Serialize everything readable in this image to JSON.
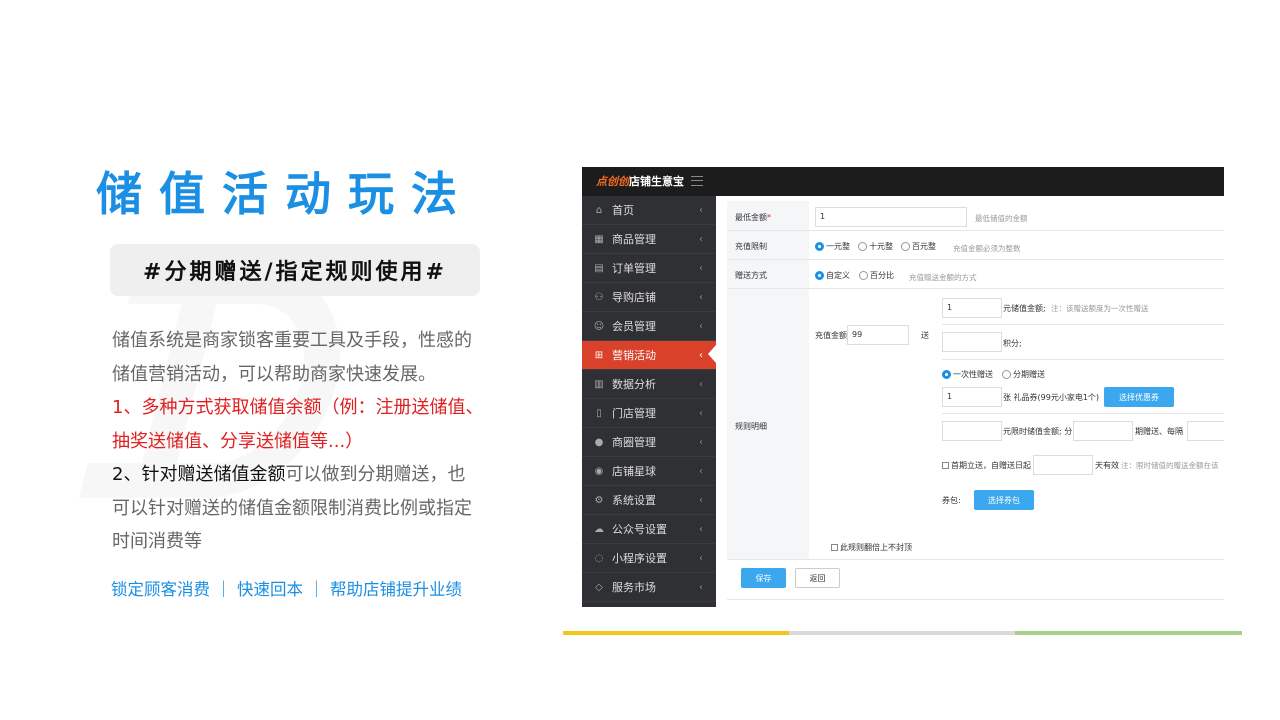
{
  "slide": {
    "title": "储值活动玩法",
    "tag": "#分期赠送/指定规则使用#",
    "desc": {
      "line1": "储值系统是商家锁客重要工具及手段，性感的",
      "line2": "储值营销活动，可以帮助商家快速发展。",
      "red1": "1、多种方式获取储值余额（例：注册送储值、",
      "red2": "抽奖送储值、分享送储值等...）",
      "item2_dark": "2、针对赠送储值金额",
      "item2_rest": "可以做到分期赠送，也",
      "line5": "可以针对赠送的储值金额限制消费比例或指定",
      "line6": "时间消费等"
    },
    "slogan": "锁定顾客消费 ｜ 快速回本 ｜  帮助店铺提升业绩",
    "bar_colors": [
      "#f5c518",
      "#d9d9d9",
      "#a8d08d"
    ]
  },
  "app": {
    "logo_accent": "点创创",
    "logo_text": "店铺生意宝",
    "sidebar": [
      {
        "label": "首页",
        "icon": "home-icon",
        "glyph": "⌂"
      },
      {
        "label": "商品管理",
        "icon": "grid-icon",
        "glyph": "▦"
      },
      {
        "label": "订单管理",
        "icon": "document-icon",
        "glyph": "▤"
      },
      {
        "label": "导购店铺",
        "icon": "org-icon",
        "glyph": "⚇"
      },
      {
        "label": "会员管理",
        "icon": "user-icon",
        "glyph": "☺"
      },
      {
        "label": "营销活动",
        "icon": "gift-icon",
        "glyph": "⊞"
      },
      {
        "label": "数据分析",
        "icon": "bar-chart-icon",
        "glyph": "▥"
      },
      {
        "label": "门店管理",
        "icon": "store-icon",
        "glyph": "▯"
      },
      {
        "label": "商圈管理",
        "icon": "circle-icon",
        "glyph": "●"
      },
      {
        "label": "店铺星球",
        "icon": "globe-icon",
        "glyph": "◉"
      },
      {
        "label": "系统设置",
        "icon": "gear-icon",
        "glyph": "⚙"
      },
      {
        "label": "公众号设置",
        "icon": "wechat-icon",
        "glyph": "☁"
      },
      {
        "label": "小程序设置",
        "icon": "chat-icon",
        "glyph": "◌"
      },
      {
        "label": "服务市场",
        "icon": "tag-icon",
        "glyph": "◇"
      }
    ],
    "chevron": "‹",
    "form": {
      "min_amount_label": "最低金额",
      "required_mark": "*",
      "min_amount_value": "1",
      "min_amount_hint": "最低储值的金额",
      "limit_label": "充值限制",
      "limit_options": [
        "一元整",
        "十元整",
        "百元整"
      ],
      "limit_hint": "充值金额必须为整数",
      "gift_method_label": "赠送方式",
      "gift_options": [
        "自定义",
        "百分比"
      ],
      "gift_hint": "充值赠送金额的方式",
      "rule_label": "规则明细",
      "recharge_label": "充值金额",
      "recharge_value": "99",
      "send_label": "送",
      "gift_value": "1",
      "gift_unit": "元储值金额;",
      "gift_note": "注：该赠送额度为一次性赠送",
      "points_unit": "积分;",
      "send_mode_options": [
        "一次性赠送",
        "分期赠送"
      ],
      "coupon_count": "1",
      "coupon_text": "张 礼品券(99元小家电1个)",
      "select_coupon_btn": "选择优惠券",
      "limit_amount_text": "元限时储值金额; 分",
      "period_text": "期赠送、每隔",
      "first_period_text": "首期立送，自赠送日起",
      "valid_text": "天有效",
      "valid_note": "注：限时储值的赠送金额在该",
      "bundle_label": "券包:",
      "select_bundle_btn": "选择券包",
      "no_cap_text": "此规则翻倍上不封顶",
      "save_btn": "保存",
      "back_btn": "返回"
    }
  }
}
